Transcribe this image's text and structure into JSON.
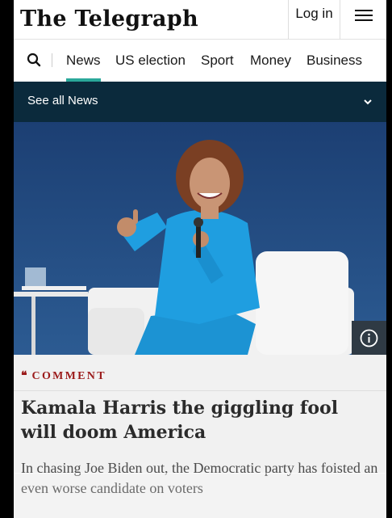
{
  "header": {
    "logo": "The Telegraph",
    "login_label": "Log in",
    "menu_icon": "hamburger-icon"
  },
  "nav": {
    "search_icon": "search-icon",
    "items": [
      {
        "label": "News",
        "active": true
      },
      {
        "label": "US election",
        "active": false
      },
      {
        "label": "Sport",
        "active": false
      },
      {
        "label": "Money",
        "active": false
      },
      {
        "label": "Business",
        "active": false
      }
    ],
    "accent_color": "#2aa89a"
  },
  "section_bar": {
    "label": "See all News",
    "icon": "chevron-down-icon",
    "background": "#0b2a3c"
  },
  "hero": {
    "info_icon": "info-icon"
  },
  "article": {
    "kicker_icon": "quote-icon",
    "kicker": "COMMENT",
    "kicker_color": "#9b1b1b",
    "headline": "Kamala Harris the giggling fool will doom America",
    "standfirst": "In chasing Joe Biden out, the Democratic party has foisted an even worse candidate on voters"
  }
}
